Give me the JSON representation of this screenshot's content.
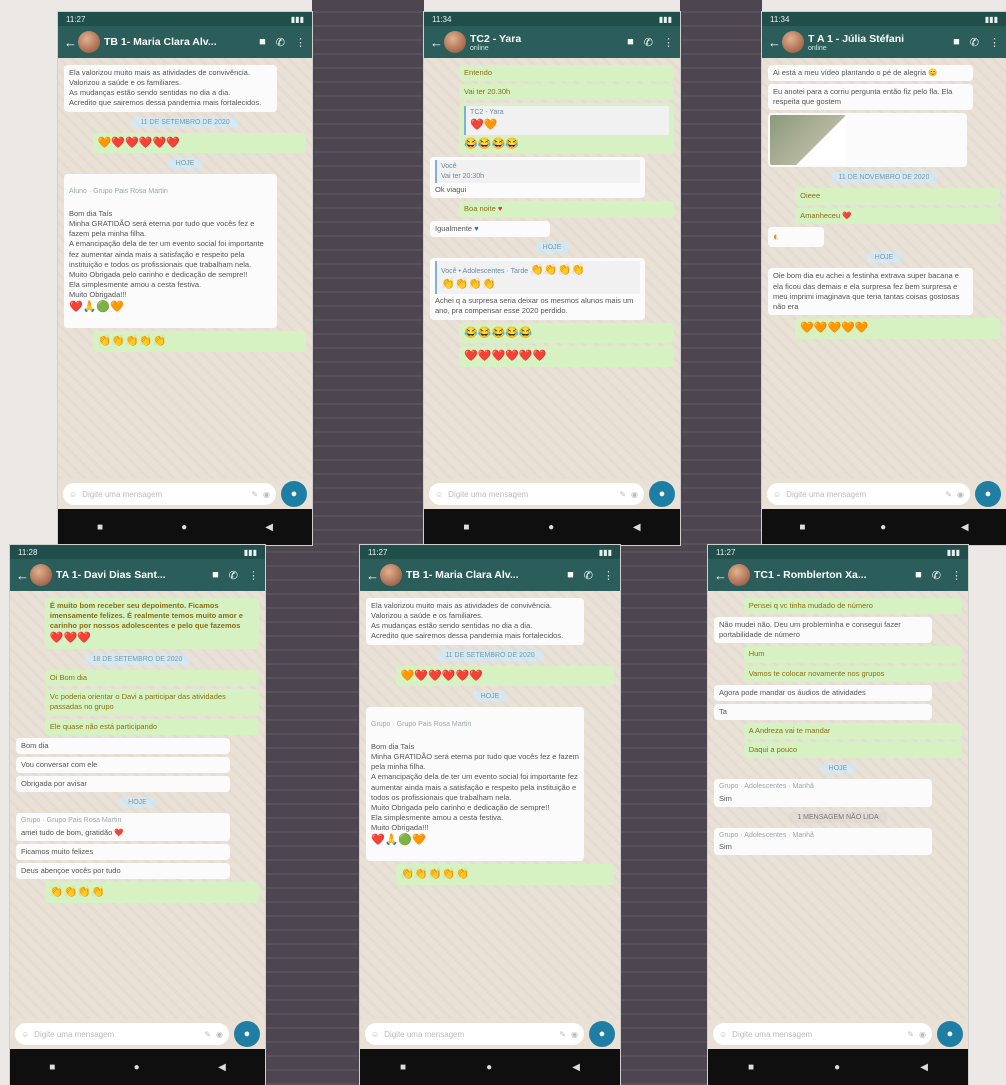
{
  "colors": {
    "header": "#2b5e5b",
    "out_bubble": "#d7f2c2",
    "in_bubble": "#fbfbfb",
    "mic": "#1f7ea3"
  },
  "status": {
    "p1": "11:27",
    "p2": "11:34",
    "p3": "11:34",
    "p4": "11:28",
    "p5": "11:27",
    "p6": "11:27"
  },
  "placeholder": "Digite uma mensagem",
  "hoje": "HOJE",
  "p1": {
    "title": "TB 1- Maria Clara Alv...",
    "m1": "Ela valorizou muito mais as atividades de convivência. Valorizou a saúde e os familiares.\nAs mudanças estão sendo sentidas no dia a dia.\nAcredito que sairemos dessa pandemia mais fortalecidos.",
    "date": "11 DE SETEMBRO DE 2020",
    "hearts": "🧡❤️❤️❤️❤️❤️",
    "fwd_sender": "Aluno · Grupo Pais Rosa  Martin",
    "m2": "Bom dia Taís\nMinha GRATIDÃO será eterna por tudo que vocês fez e fazem pela minha filha.\nA emancipação dela de ter um evento social foi importante fez aumentar ainda mais a satisfação e respeito pela instituição e todos os profissionais que trabalham nela.\nMuito Obrigada pelo carinho e dedicação de sempre!!\nEla simplesmente amou a cesta festiva.\nMuito Obrigada!!!",
    "m2_emoji": "❤️🙏🟢🧡",
    "m3": "👏👏👏👏👏"
  },
  "p2": {
    "title": "TC2 - Yara",
    "subtitle": "online",
    "o1": "Entendo",
    "o2": "Vai ter 20.30h",
    "q_name": "TC2 - Yara",
    "q_emoji": "❤️🧡",
    "o3": "😂😂😂😂",
    "i_sender": "Você",
    "i_meta": "Vai ter 20:30h",
    "i1": "Ok viagui",
    "o4": "Boa noite",
    "i2": "Igualmente",
    "q2_name": "Você • Adolescentes · Tarde",
    "q2_emoji": "👏👏👏👏",
    "q2_emoji2": "👏👏👏👏",
    "i3": "Achei q a surpresa seria deixar os mesmos alunos mais um ano, pra compensar esse 2020 perdido.",
    "o5": "😂😂😂😂😂",
    "o6": "❤️❤️❤️❤️❤️❤️"
  },
  "p3": {
    "title": "T A 1 - Júlia Stéfani",
    "subtitle": "online",
    "i1": "Ai está a meu vídeo plantando o pé de alegria 😊",
    "i2": "Eu anotei para a corriu pergunta então fiz pelo fla. Ela respeita que gostem",
    "date": "11 DE NOVEMBRO DE 2020",
    "o1": "Oieee",
    "o2": "Amanheceu ❤️",
    "i3": "Oie bom dia eu achei a festinha extrava super bacana e ela ficou das demais e ela surpresa fez bem surpresa e meu imprimi imaginava que teria tantas coisas gostosas não era",
    "o3": "🧡🧡🧡🧡🧡"
  },
  "p4": {
    "title": "TA 1- Davi Dias Sant...",
    "o1": "É muito bom receber seu depoimento. Ficamos imensamente felizes. É realmente temos muito amor e carinho por nossos adolescentes e pelo que fazemos",
    "o1_emoji": "❤️❤️❤️",
    "date": "18 DE SETEMBRO DE 2020",
    "o2": "Oi Bom dia",
    "o3": "Vc poderia orientar o Davi a participar das atividades passadas no grupo",
    "o4": "Ele quase não está participando",
    "i1": "Bom dia",
    "i2": "Vou conversar com ele",
    "i3": "Obrigada por avisar",
    "fwd_sender": "Grupo · Grupo Pais Rosa  Martin",
    "i4": "amei tudo de bom, gratidão ❤️",
    "i5": "Ficamos muito felizes",
    "i6": "Deus abençoe vocês por tudo",
    "o5": "👏👏👏👏"
  },
  "p5": {
    "title": "TB 1- Maria Clara Alv...",
    "m1": "Ela valorizou muito mais as atividades de convivência. Valorizou a saúde e os familiares.\nAs mudanças estão sendo sentidas no dia a dia.\nAcredito que sairemos dessa pandemia mais fortalecidos.",
    "date": "11 DE SETEMBRO DE 2020",
    "hearts": "🧡❤️❤️❤️❤️❤️",
    "fwd_sender": "Grupo · Grupo Pais Rosa  Martin",
    "m2": "Bom dia Taís\nMinha GRATIDÃO será eterna por tudo que vocês fez e fazem pela minha filha.\nA emancipação dela de ter um evento social foi importante fez aumentar ainda mais a satisfação e respeito pela instituição e todos os profissionais que trabalham nela.\nMuito Obrigada pelo carinho e dedicação de sempre!!\nEla simplesmente amou a cesta festiva.\nMuito Obrigada!!!",
    "m2_emoji": "❤️🙏🟢🧡",
    "m3": "👏👏👏👏👏"
  },
  "p6": {
    "title": "TC1 - Romblerton Xa...",
    "o1": "Pensei q vc tinha mudado de número",
    "i1": "Não mudei não. Deu um probleminha e consegui fazer portabilidade de número",
    "o2": "Hum",
    "o3": "Vamos te colocar novamente nos grupos",
    "i2": "Agora pode mandar os áudios de atividades",
    "i3": "Ta",
    "o4": "A Andreza vai te mandar",
    "o5": "Daqui a pouco",
    "q1": "Grupo · Adolescentes · Manhã",
    "i4": "Sim",
    "sys": "1 MENSAGEM NÃO LIDA",
    "q2": "Grupo · Adolescentes · Manhã",
    "i5": "Sim"
  }
}
